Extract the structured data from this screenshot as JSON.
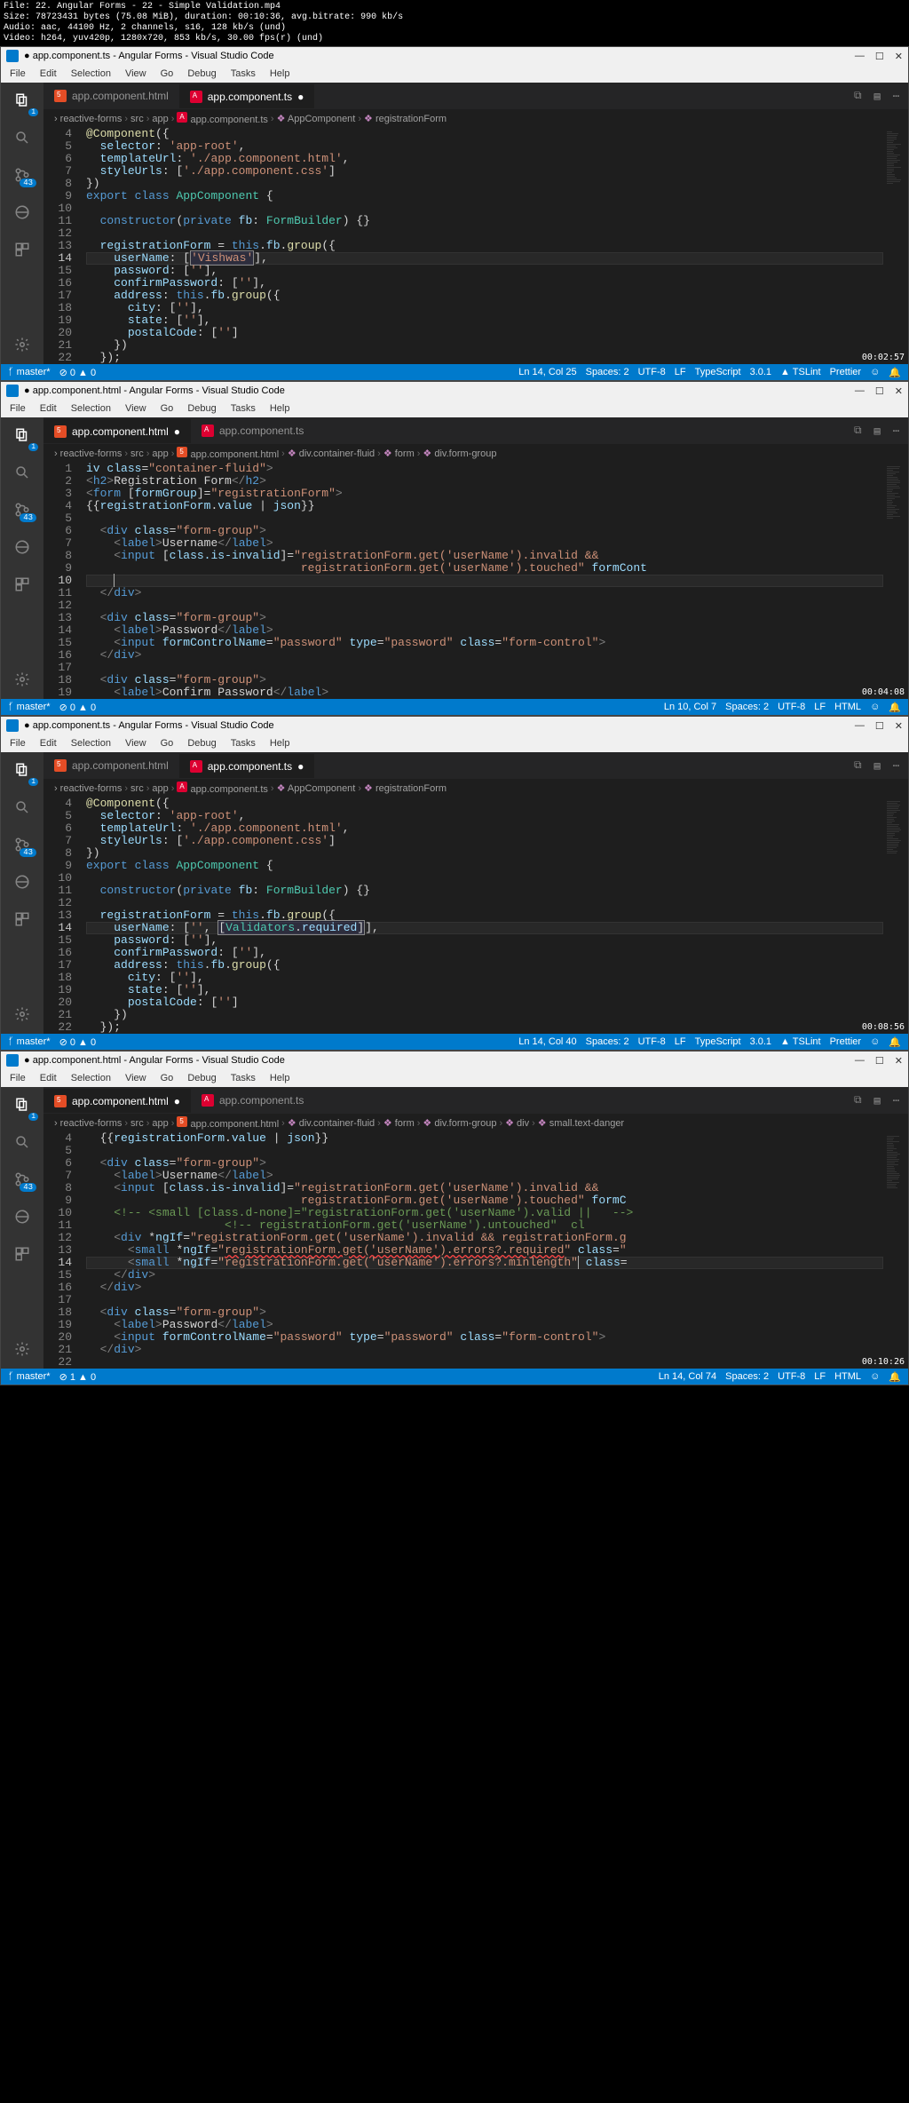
{
  "header": {
    "l1": "File: 22. Angular Forms - 22 - Simple Validation.mp4",
    "l2": "Size: 78723431 bytes (75.08 MiB), duration: 00:10:36, avg.bitrate: 990 kb/s",
    "l3": "Audio: aac, 44100 Hz, 2 channels, s16, 128 kb/s (und)",
    "l4": "Video: h264, yuv420p, 1280x720, 853 kb/s, 30.00 fps(r) (und)"
  },
  "menu": [
    "File",
    "Edit",
    "Selection",
    "View",
    "Go",
    "Debug",
    "Tasks",
    "Help"
  ],
  "w1": {
    "title": "app.component.ts - Angular Forms - Visual Studio Code",
    "tabs": {
      "inactive": "app.component.html",
      "active": "app.component.ts"
    },
    "breadcrumb": [
      "reactive-forms",
      "src",
      "app",
      "app.component.ts",
      "AppComponent",
      "registrationForm"
    ],
    "lines": [
      4,
      5,
      6,
      7,
      8,
      9,
      10,
      11,
      12,
      13,
      14,
      15,
      16,
      17,
      18,
      19,
      20,
      21,
      22
    ],
    "hl_line": 14,
    "status": {
      "branch": "master*",
      "errors": "0",
      "warnings": "0",
      "pos": "Ln 14, Col 25",
      "spaces": "Spaces: 2",
      "enc": "UTF-8",
      "eol": "LF",
      "lang": "TypeScript",
      "ver": "3.0.1",
      "lint": "TSLint",
      "fmt": "Prettier"
    },
    "ts": "00:02:57",
    "code": [
      "<span class='dec'>@Component</span><span class='pun'>({</span>",
      "  <span class='prop'>selector</span><span class='pun'>:</span> <span class='str'>'app-root'</span><span class='pun'>,</span>",
      "  <span class='prop'>templateUrl</span><span class='pun'>:</span> <span class='str'>'./app.component.html'</span><span class='pun'>,</span>",
      "  <span class='prop'>styleUrls</span><span class='pun'>:</span> <span class='pun'>[</span><span class='str'>'./app.component.css'</span><span class='pun'>]</span>",
      "<span class='pun'>})</span>",
      "<span class='k'>export</span> <span class='k'>class</span> <span class='cls'>AppComponent</span> <span class='pun'>{</span>",
      "",
      "  <span class='k'>constructor</span><span class='pun'>(</span><span class='k'>private</span> <span class='prop'>fb</span><span class='pun'>:</span> <span class='cls'>FormBuilder</span><span class='pun'>) {}</span>",
      "",
      "  <span class='prop'>registrationForm</span> <span class='op'>=</span> <span class='k'>this</span><span class='pun'>.</span><span class='prop'>fb</span><span class='pun'>.</span><span class='fn'>group</span><span class='pun'>({</span>",
      "    <span class='prop'>userName</span><span class='pun'>:</span> <span class='pun'>[</span><span class='sel'><span class='str'>'Vishwas'</span></span><span class='pun'>],</span>",
      "    <span class='prop'>password</span><span class='pun'>:</span> <span class='pun'>[</span><span class='str'>''</span><span class='pun'>],</span>",
      "    <span class='prop'>confirmPassword</span><span class='pun'>:</span> <span class='pun'>[</span><span class='str'>''</span><span class='pun'>],</span>",
      "    <span class='prop'>address</span><span class='pun'>:</span> <span class='k'>this</span><span class='pun'>.</span><span class='prop'>fb</span><span class='pun'>.</span><span class='fn'>group</span><span class='pun'>({</span>",
      "      <span class='prop'>city</span><span class='pun'>:</span> <span class='pun'>[</span><span class='str'>''</span><span class='pun'>],</span>",
      "      <span class='prop'>state</span><span class='pun'>:</span> <span class='pun'>[</span><span class='str'>''</span><span class='pun'>],</span>",
      "      <span class='prop'>postalCode</span><span class='pun'>:</span> <span class='pun'>[</span><span class='str'>''</span><span class='pun'>]</span>",
      "    <span class='pun'>})</span>",
      "  <span class='pun'>});</span>"
    ]
  },
  "w2": {
    "title": "app.component.html - Angular Forms - Visual Studio Code",
    "tabs": {
      "active": "app.component.html",
      "inactive": "app.component.ts"
    },
    "breadcrumb": [
      "reactive-forms",
      "src",
      "app",
      "app.component.html",
      "div.container-fluid",
      "form",
      "div.form-group"
    ],
    "lines": [
      1,
      2,
      3,
      4,
      5,
      6,
      7,
      8,
      9,
      10,
      11,
      12,
      13,
      14,
      15,
      16,
      17,
      18,
      19
    ],
    "hl_line": 10,
    "status": {
      "branch": "master*",
      "errors": "0",
      "warnings": "0",
      "pos": "Ln 10, Col 7",
      "spaces": "Spaces: 2",
      "enc": "UTF-8",
      "eol": "LF",
      "lang": "HTML"
    },
    "ts": "00:04:08",
    "code": [
      "<span class='prop'>iv</span> <span class='attr'>class</span><span class='pun'>=</span><span class='str'>\"container-fluid\"</span><span class='brk'>&gt;</span>",
      "<span class='brk'>&lt;</span><span class='tag'>h2</span><span class='brk'>&gt;</span>Registration Form<span class='brk'>&lt;/</span><span class='tag'>h2</span><span class='brk'>&gt;</span>",
      "<span class='brk'>&lt;</span><span class='tag'>form</span> <span class='pun'>[</span><span class='attr'>formGroup</span><span class='pun'>]=</span><span class='str'>\"registrationForm\"</span><span class='brk'>&gt;</span>",
      "<span class='pun'>{{</span><span class='prop'>registrationForm</span><span class='pun'>.</span><span class='prop'>value</span> <span class='pun'>|</span> <span class='prop'>json</span><span class='pun'>}}</span>",
      "",
      "  <span class='brk'>&lt;</span><span class='tag'>div</span> <span class='attr'>class</span><span class='pun'>=</span><span class='str'>\"form-group\"</span><span class='brk'>&gt;</span>",
      "    <span class='brk'>&lt;</span><span class='tag'>label</span><span class='brk'>&gt;</span>Username<span class='brk'>&lt;/</span><span class='tag'>label</span><span class='brk'>&gt;</span>",
      "    <span class='brk'>&lt;</span><span class='tag'>input</span> <span class='pun'>[</span><span class='attr'>class.is-invalid</span><span class='pun'>]=</span><span class='str'>\"registrationForm.get('userName').invalid &amp;&amp;</span>",
      "<span class='str'>                               registrationForm.get('userName').touched\"</span> <span class='attr'>formCont</span>",
      "    <span style='border-left:1px solid #aeafad;'></span>",
      "  <span class='brk'>&lt;/</span><span class='tag'>div</span><span class='brk'>&gt;</span>",
      "",
      "  <span class='brk'>&lt;</span><span class='tag'>div</span> <span class='attr'>class</span><span class='pun'>=</span><span class='str'>\"form-group\"</span><span class='brk'>&gt;</span>",
      "    <span class='brk'>&lt;</span><span class='tag'>label</span><span class='brk'>&gt;</span>Password<span class='brk'>&lt;/</span><span class='tag'>label</span><span class='brk'>&gt;</span>",
      "    <span class='brk'>&lt;</span><span class='tag'>input</span> <span class='attr'>formControlName</span><span class='pun'>=</span><span class='str'>\"password\"</span> <span class='attr'>type</span><span class='pun'>=</span><span class='str'>\"password\"</span> <span class='attr'>class</span><span class='pun'>=</span><span class='str'>\"form-control\"</span><span class='brk'>&gt;</span>",
      "  <span class='brk'>&lt;/</span><span class='tag'>div</span><span class='brk'>&gt;</span>",
      "",
      "  <span class='brk'>&lt;</span><span class='tag'>div</span> <span class='attr'>class</span><span class='pun'>=</span><span class='str'>\"form-group\"</span><span class='brk'>&gt;</span>",
      "    <span class='brk'>&lt;</span><span class='tag'>label</span><span class='brk'>&gt;</span>Confirm Password<span class='brk'>&lt;/</span><span class='tag'>label</span><span class='brk'>&gt;</span>"
    ]
  },
  "w3": {
    "title": "app.component.ts - Angular Forms - Visual Studio Code",
    "tabs": {
      "inactive": "app.component.html",
      "active": "app.component.ts"
    },
    "breadcrumb": [
      "reactive-forms",
      "src",
      "app",
      "app.component.ts",
      "AppComponent",
      "registrationForm"
    ],
    "lines": [
      4,
      5,
      6,
      7,
      8,
      9,
      10,
      11,
      12,
      13,
      14,
      15,
      16,
      17,
      18,
      19,
      20,
      21,
      22
    ],
    "hl_line": 14,
    "status": {
      "branch": "master*",
      "errors": "0",
      "warnings": "0",
      "pos": "Ln 14, Col 40",
      "spaces": "Spaces: 2",
      "enc": "UTF-8",
      "eol": "LF",
      "lang": "TypeScript",
      "ver": "3.0.1",
      "lint": "TSLint",
      "fmt": "Prettier"
    },
    "ts": "00:08:56",
    "code": [
      "<span class='dec'>@Component</span><span class='pun'>({</span>",
      "  <span class='prop'>selector</span><span class='pun'>:</span> <span class='str'>'app-root'</span><span class='pun'>,</span>",
      "  <span class='prop'>templateUrl</span><span class='pun'>:</span> <span class='str'>'./app.component.html'</span><span class='pun'>,</span>",
      "  <span class='prop'>styleUrls</span><span class='pun'>:</span> <span class='pun'>[</span><span class='str'>'./app.component.css'</span><span class='pun'>]</span>",
      "<span class='pun'>})</span>",
      "<span class='k'>export</span> <span class='k'>class</span> <span class='cls'>AppComponent</span> <span class='pun'>{</span>",
      "",
      "  <span class='k'>constructor</span><span class='pun'>(</span><span class='k'>private</span> <span class='prop'>fb</span><span class='pun'>:</span> <span class='cls'>FormBuilder</span><span class='pun'>) {}</span>",
      "",
      "  <span class='prop'>registrationForm</span> <span class='op'>=</span> <span class='k'>this</span><span class='pun'>.</span><span class='prop'>fb</span><span class='pun'>.</span><span class='fn'>group</span><span class='pun'>({</span>",
      "    <span class='prop'>userName</span><span class='pun'>:</span> <span class='pun'>[</span><span class='str'>''</span><span class='pun'>,</span> <span class='sel'><span class='pun'>[</span><span class='cls'>Validators</span><span class='pun'>.</span><span class='prop'>required</span><span class='pun'>]</span></span><span class='pun'>],</span>",
      "    <span class='prop'>password</span><span class='pun'>:</span> <span class='pun'>[</span><span class='str'>''</span><span class='pun'>],</span>",
      "    <span class='prop'>confirmPassword</span><span class='pun'>:</span> <span class='pun'>[</span><span class='str'>''</span><span class='pun'>],</span>",
      "    <span class='prop'>address</span><span class='pun'>:</span> <span class='k'>this</span><span class='pun'>.</span><span class='prop'>fb</span><span class='pun'>.</span><span class='fn'>group</span><span class='pun'>({</span>",
      "      <span class='prop'>city</span><span class='pun'>:</span> <span class='pun'>[</span><span class='str'>''</span><span class='pun'>],</span>",
      "      <span class='prop'>state</span><span class='pun'>:</span> <span class='pun'>[</span><span class='str'>''</span><span class='pun'>],</span>",
      "      <span class='prop'>postalCode</span><span class='pun'>:</span> <span class='pun'>[</span><span class='str'>''</span><span class='pun'>]</span>",
      "    <span class='pun'>})</span>",
      "  <span class='pun'>});</span>"
    ]
  },
  "w4": {
    "title": "app.component.html - Angular Forms - Visual Studio Code",
    "tabs": {
      "active": "app.component.html",
      "inactive": "app.component.ts"
    },
    "breadcrumb": [
      "reactive-forms",
      "src",
      "app",
      "app.component.html",
      "div.container-fluid",
      "form",
      "div.form-group",
      "div",
      "small.text-danger"
    ],
    "lines": [
      4,
      5,
      6,
      7,
      8,
      9,
      10,
      11,
      12,
      13,
      14,
      15,
      16,
      17,
      18,
      19,
      20,
      21,
      22
    ],
    "hl_line": 14,
    "status": {
      "branch": "master*",
      "errors": "1",
      "warnings": "0",
      "pos": "Ln 14, Col 74",
      "spaces": "Spaces: 2",
      "enc": "UTF-8",
      "eol": "LF",
      "lang": "HTML"
    },
    "ts": "00:10:26",
    "code": [
      "  <span class='pun'>{{</span><span class='prop'>registrationForm</span><span class='pun'>.</span><span class='prop'>value</span> <span class='pun'>|</span> <span class='prop'>json</span><span class='pun'>}}</span>",
      "",
      "  <span class='brk'>&lt;</span><span class='tag'>div</span> <span class='attr'>class</span><span class='pun'>=</span><span class='str'>\"form-group\"</span><span class='brk'>&gt;</span>",
      "    <span class='brk'>&lt;</span><span class='tag'>label</span><span class='brk'>&gt;</span>Username<span class='brk'>&lt;/</span><span class='tag'>label</span><span class='brk'>&gt;</span>",
      "    <span class='brk'>&lt;</span><span class='tag'>input</span> <span class='pun'>[</span><span class='attr'>class.is-invalid</span><span class='pun'>]=</span><span class='str'>\"registrationForm.get('userName').invalid &amp;&amp;</span>",
      "<span class='str'>                               registrationForm.get('userName').touched\"</span> <span class='attr'>formC</span>",
      "    <span class='cmt'>&lt;!-- &lt;small [class.d-none]=\"registrationForm.get('userName').valid ||   --&gt;</span>",
      "                    <span class='cmt'>&lt;!-- registrationForm.get('userName').untouched\"  cl</span>",
      "    <span class='brk'>&lt;</span><span class='tag'>div</span> <span class='pun'>*</span><span class='attr'>ngIf</span><span class='pun'>=</span><span class='str'>\"registrationForm.get('userName').invalid &amp;&amp; registrationForm.g</span>",
      "      <span class='brk'>&lt;</span><span class='tag'>small</span> <span class='pun'>*</span><span class='attr'>ngIf</span><span class='pun'>=</span><span class='str'>\"<span style='text-decoration:underline wavy #f44;'>registrationForm.get('userName').errors?.required</span>\"</span> <span class='attr'>class</span><span class='pun'>=</span><span class='str'>\"</span>",
      "      <span class='brk'>&lt;</span><span class='tag'>small</span> <span class='pun'>*</span><span class='attr'>ngIf</span><span class='pun'>=</span><span class='str'>\"registrationForm.get('userName').errors?.minlength\"</span><span style='border-left:1px solid #aeafad;'></span> <span class='attr'>class</span><span class='pun'>=</span>",
      "    <span class='brk'>&lt;/</span><span class='tag'>div</span><span class='brk'>&gt;</span>",
      "  <span class='brk'>&lt;/</span><span class='tag'>div</span><span class='brk'>&gt;</span>",
      "",
      "  <span class='brk'>&lt;</span><span class='tag'>div</span> <span class='attr'>class</span><span class='pun'>=</span><span class='str'>\"form-group\"</span><span class='brk'>&gt;</span>",
      "    <span class='brk'>&lt;</span><span class='tag'>label</span><span class='brk'>&gt;</span>Password<span class='brk'>&lt;/</span><span class='tag'>label</span><span class='brk'>&gt;</span>",
      "    <span class='brk'>&lt;</span><span class='tag'>input</span> <span class='attr'>formControlName</span><span class='pun'>=</span><span class='str'>\"password\"</span> <span class='attr'>type</span><span class='pun'>=</span><span class='str'>\"password\"</span> <span class='attr'>class</span><span class='pun'>=</span><span class='str'>\"form-control\"</span><span class='brk'>&gt;</span>",
      "  <span class='brk'>&lt;/</span><span class='tag'>div</span><span class='brk'>&gt;</span>",
      ""
    ]
  },
  "badge": "43"
}
